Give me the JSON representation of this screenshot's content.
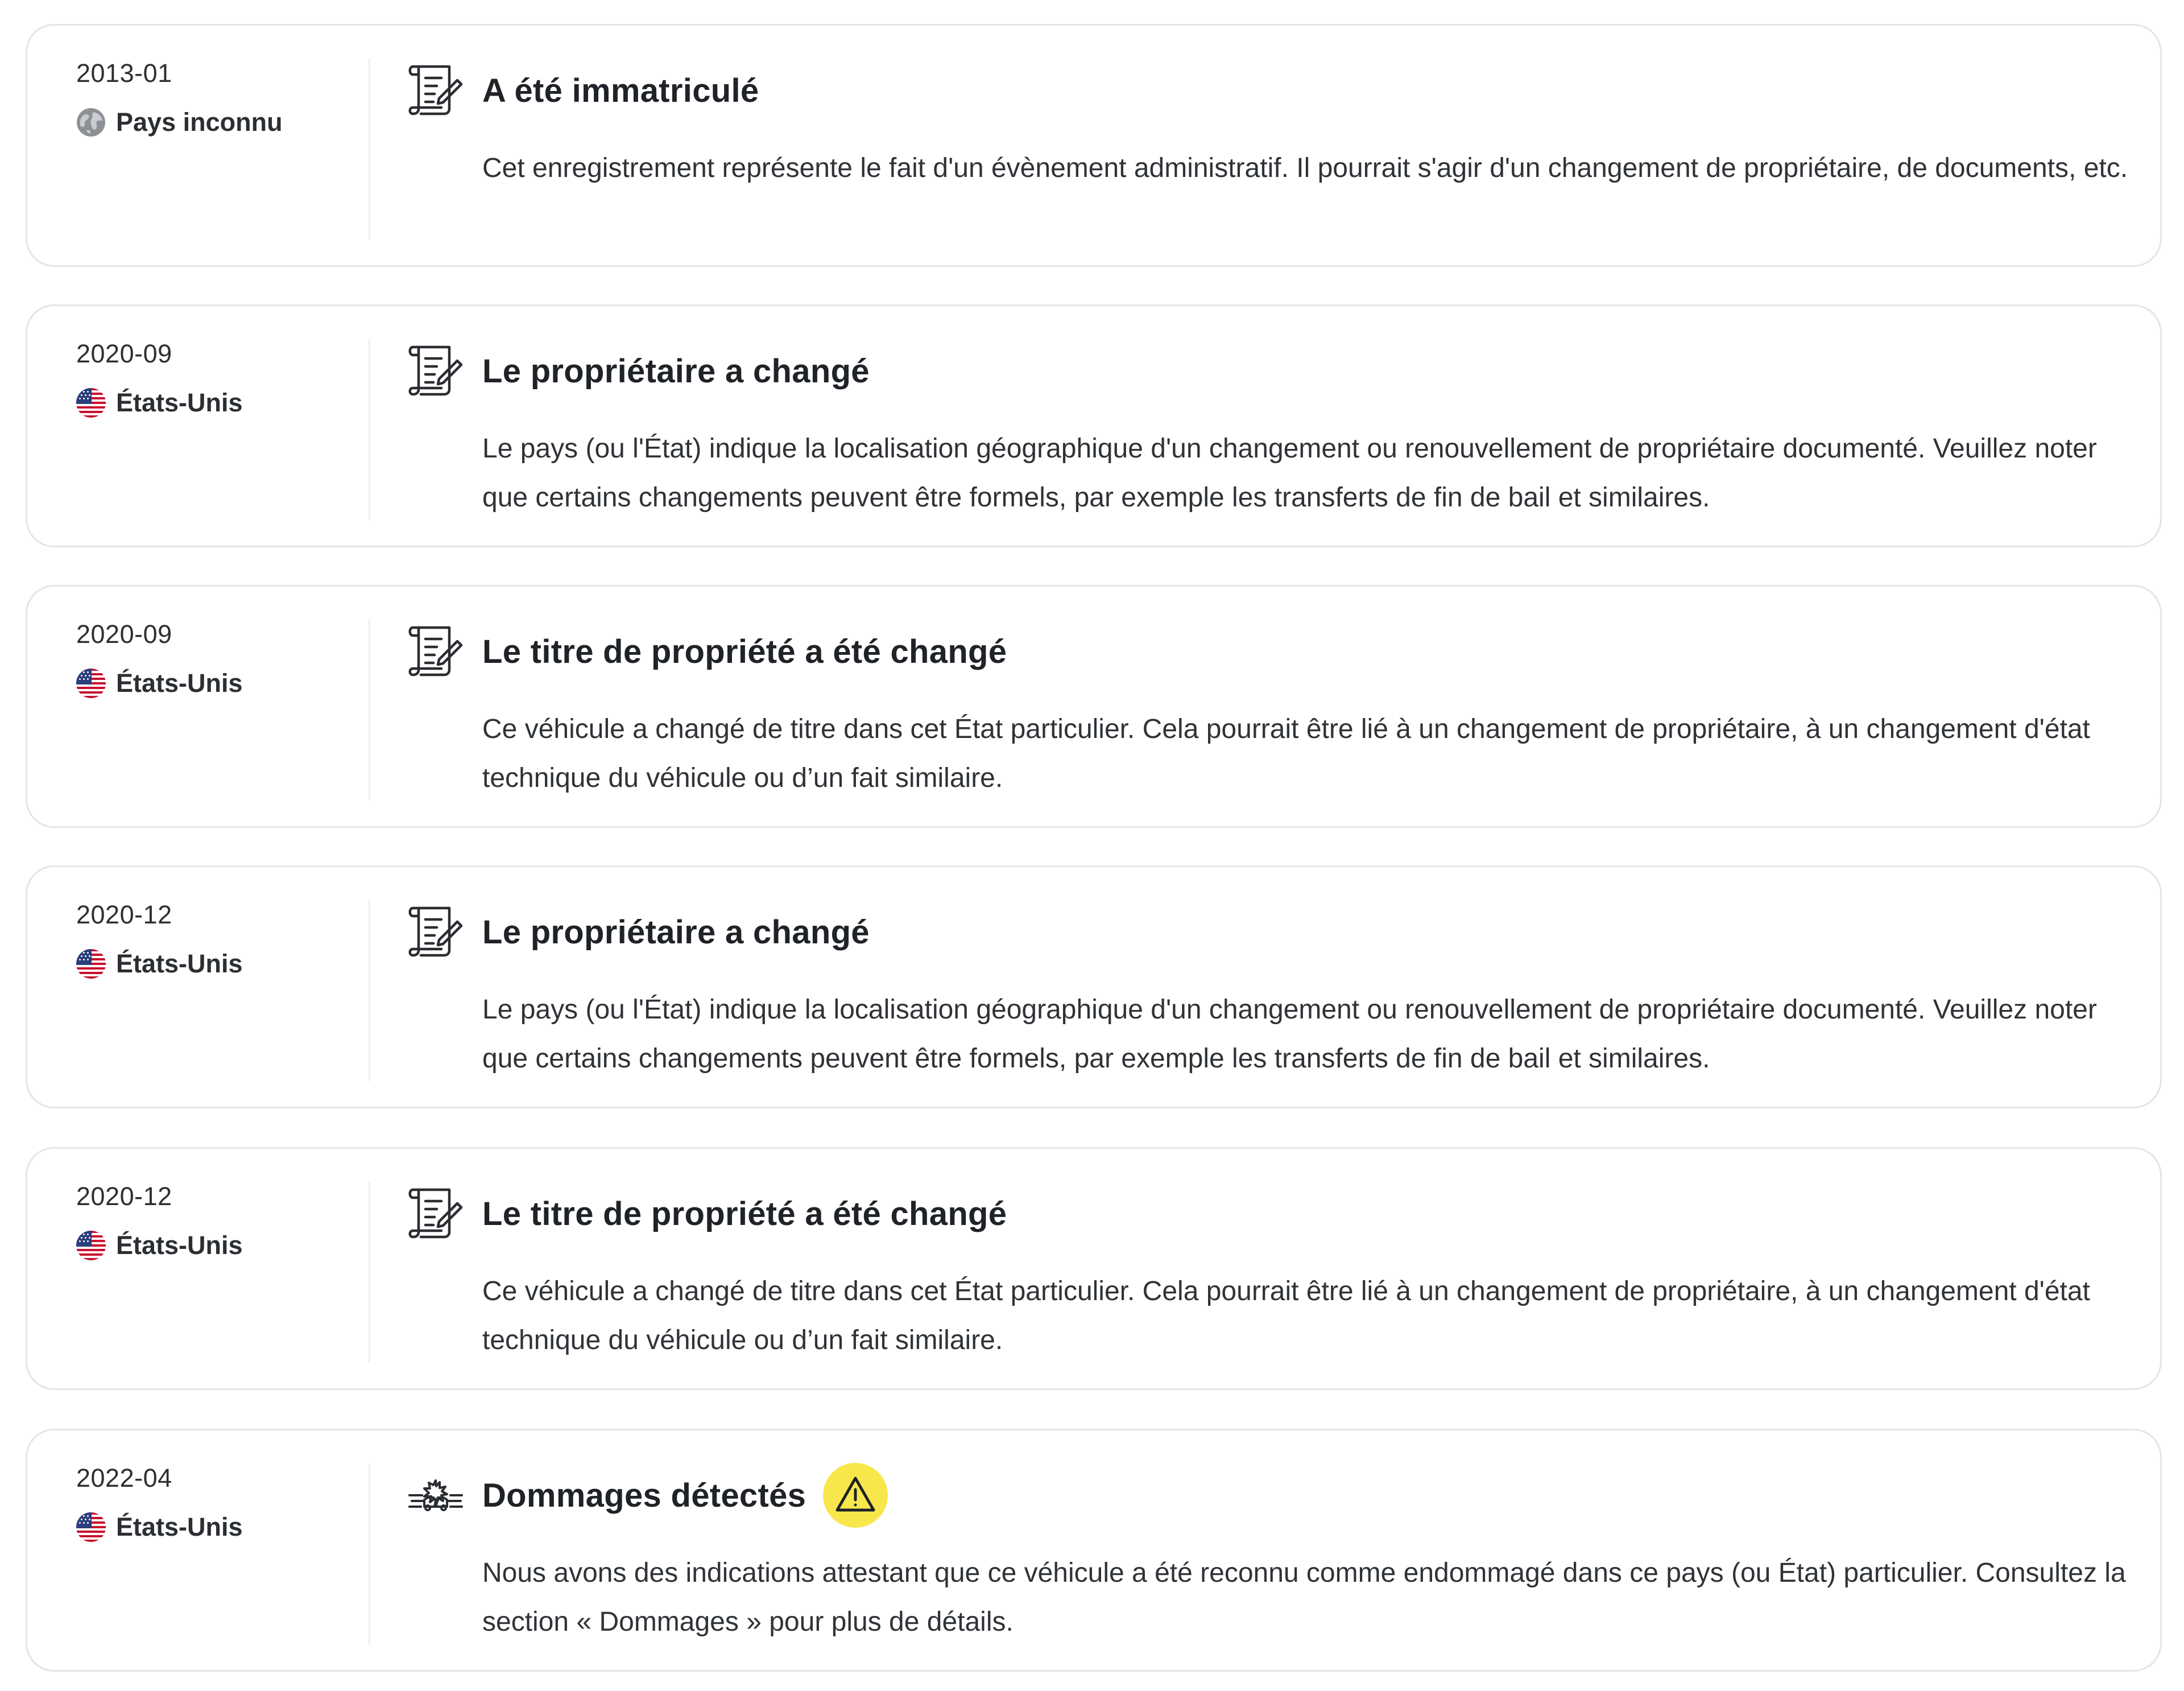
{
  "events": [
    {
      "date": "2013-01",
      "country": "Pays inconnu",
      "country_icon": "globe-icon",
      "event_icon": "scroll-document-icon",
      "title": "A été immatriculé",
      "description": "Cet enregistrement représente le fait d'un évènement administratif. Il pourrait s'agir d'un changement de propriétaire, de documents, etc."
    },
    {
      "date": "2020-09",
      "country": "États-Unis",
      "country_icon": "us-flag-icon",
      "event_icon": "scroll-document-icon",
      "title": "Le propriétaire a changé",
      "description": "Le pays (ou l'État) indique la localisation géographique d'un changement ou renouvellement de propriétaire documenté. Veuillez noter que certains changements peuvent être formels, par exemple les transferts de fin de bail et similaires."
    },
    {
      "date": "2020-09",
      "country": "États-Unis",
      "country_icon": "us-flag-icon",
      "event_icon": "scroll-document-icon",
      "title": "Le titre de propriété a été changé",
      "description": "Ce véhicule a changé de titre dans cet État particulier. Cela pourrait être lié à un changement de propriétaire, à un changement d'état technique du véhicule ou d’un fait similaire."
    },
    {
      "date": "2020-12",
      "country": "États-Unis",
      "country_icon": "us-flag-icon",
      "event_icon": "scroll-document-icon",
      "title": "Le propriétaire a changé",
      "description": "Le pays (ou l'État) indique la localisation géographique d'un changement ou renouvellement de propriétaire documenté. Veuillez noter que certains changements peuvent être formels, par exemple les transferts de fin de bail et similaires."
    },
    {
      "date": "2020-12",
      "country": "États-Unis",
      "country_icon": "us-flag-icon",
      "event_icon": "scroll-document-icon",
      "title": "Le titre de propriété a été changé",
      "description": "Ce véhicule a changé de titre dans cet État particulier. Cela pourrait être lié à un changement de propriétaire, à un changement d'état technique du véhicule ou d’un fait similaire."
    },
    {
      "date": "2022-04",
      "country": "États-Unis",
      "country_icon": "us-flag-icon",
      "event_icon": "car-crash-icon",
      "title": "Dommages détectés",
      "warning_icon": "warning-triangle-icon",
      "warning_color": "#f8e74b",
      "description": "Nous avons des indications attestant que ce véhicule a été reconnu comme endommagé dans ce pays (ou État) particulier. Consultez la section « Dommages » pour plus de détails."
    }
  ]
}
